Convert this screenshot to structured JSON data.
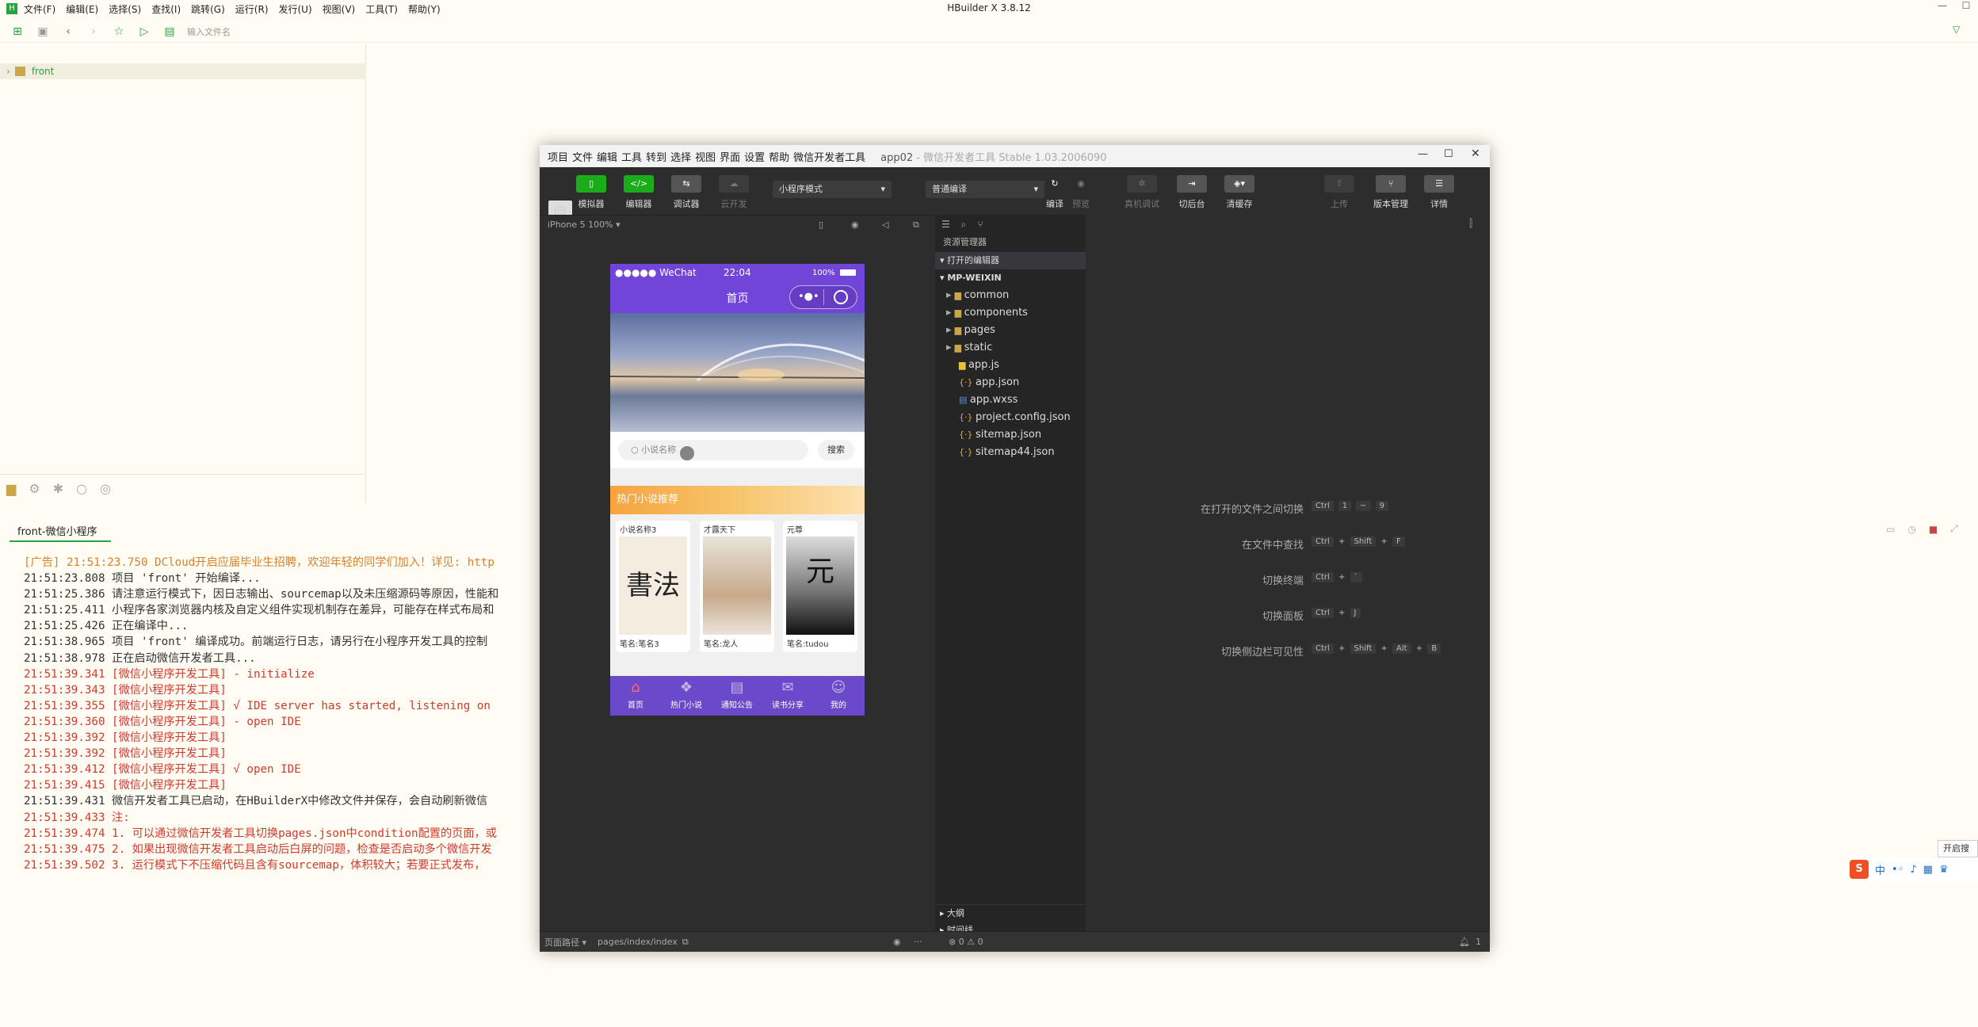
{
  "hbuilder": {
    "title": "HBuilder X 3.8.12",
    "menu": [
      "文件(F)",
      "编辑(E)",
      "选择(S)",
      "查找(I)",
      "跳转(G)",
      "运行(R)",
      "发行(U)",
      "视图(V)",
      "工具(T)",
      "帮助(Y)"
    ],
    "address_placeholder": "输入文件名",
    "project": "front",
    "console_tab": "front-微信小程序",
    "console_lines": [
      {
        "cls": "ln-ad",
        "text": "[广告] 21:51:23.750 DCloud开启应届毕业生招聘，欢迎年轻的同学们加入！详见: http"
      },
      {
        "cls": "ln-plain",
        "text": "21:51:23.808 项目 'front' 开始编译..."
      },
      {
        "cls": "ln-plain",
        "text": "21:51:25.386 请注意运行模式下，因日志输出、sourcemap以及未压缩源码等原因，性能和"
      },
      {
        "cls": "ln-plain",
        "text": "21:51:25.411 小程序各家浏览器内核及自定义组件实现机制存在差异，可能存在样式布局和"
      },
      {
        "cls": "ln-plain",
        "text": "21:51:25.426 正在编译中..."
      },
      {
        "cls": "ln-plain",
        "text": "21:51:38.965 项目 'front' 编译成功。前端运行日志，请另行在小程序开发工具的控制"
      },
      {
        "cls": "ln-plain",
        "text": "21:51:38.978 正在启动微信开发者工具..."
      },
      {
        "cls": "ln-red",
        "text": "21:51:39.341 [微信小程序开发工具] - initialize"
      },
      {
        "cls": "ln-red",
        "text": "21:51:39.343 [微信小程序开发工具]"
      },
      {
        "cls": "ln-red",
        "text": "21:51:39.355 [微信小程序开发工具] √ IDE server has started, listening on"
      },
      {
        "cls": "ln-red",
        "text": "21:51:39.360 [微信小程序开发工具] - open IDE"
      },
      {
        "cls": "ln-red",
        "text": "21:51:39.392 [微信小程序开发工具]"
      },
      {
        "cls": "ln-red",
        "text": "21:51:39.392 [微信小程序开发工具]"
      },
      {
        "cls": "ln-red",
        "text": "21:51:39.412 [微信小程序开发工具] √ open IDE"
      },
      {
        "cls": "ln-red",
        "text": "21:51:39.415 [微信小程序开发工具]"
      },
      {
        "cls": "ln-plain",
        "text": "21:51:39.431 微信开发者工具已启动，在HBuilderX中修改文件并保存，会自动刷新微信"
      },
      {
        "cls": "ln-red",
        "text": "21:51:39.433 注:"
      },
      {
        "cls": "ln-red",
        "text": "21:51:39.474 1. 可以通过微信开发者工具切换pages.json中condition配置的页面，或"
      },
      {
        "cls": "ln-red",
        "text": "21:51:39.475 2. 如果出现微信开发者工具启动后白屏的问题，检查是否启动多个微信开发"
      },
      {
        "cls": "ln-red",
        "text": "21:51:39.502 3. 运行模式下不压缩代码且含有sourcemap，体积较大；若要正式发布，"
      }
    ]
  },
  "wx": {
    "menu": [
      "项目",
      "文件",
      "编辑",
      "工具",
      "转到",
      "选择",
      "视图",
      "界面",
      "设置",
      "帮助",
      "微信开发者工具"
    ],
    "title_app": "app02",
    "title_rest": " - 微信开发者工具 Stable 1.03.2006090",
    "toolbar": {
      "simulator": "模拟器",
      "editor": "编辑器",
      "debugger": "调试器",
      "cloud": "云开发",
      "mode_select": "小程序模式",
      "compile_select": "普通编译",
      "compile": "编译",
      "preview": "预览",
      "remote_debug": "真机调试",
      "backend": "切后台",
      "clear_cache": "清缓存",
      "upload": "上传",
      "version": "版本管理",
      "details": "详情"
    },
    "device": "iPhone 5 100% ▾",
    "phone": {
      "carrier": "●●●●● WeChat",
      "time": "22:04",
      "battery": "100%",
      "nav_title": "首页",
      "search_placeholder": "小说名称",
      "search_btn": "搜索",
      "hot_title": "热门小说推荐",
      "cards": [
        {
          "title": "小说名称3",
          "author": "笔名:笔名3"
        },
        {
          "title": "才露天下",
          "author": "笔名:龙人"
        },
        {
          "title": "元尊",
          "author": "笔名:tudou"
        }
      ],
      "tabs": [
        "首页",
        "热门小说",
        "通知公告",
        "读书分享",
        "我的"
      ]
    },
    "explorer": {
      "header": "资源管理器",
      "open_editors": "打开的编辑器",
      "root": "MP-WEIXIN",
      "items": [
        {
          "name": "common",
          "type": "folder"
        },
        {
          "name": "components",
          "type": "folder"
        },
        {
          "name": "pages",
          "type": "folder"
        },
        {
          "name": "static",
          "type": "folder"
        },
        {
          "name": "app.js",
          "type": "js"
        },
        {
          "name": "app.json",
          "type": "json"
        },
        {
          "name": "app.wxss",
          "type": "wxss"
        },
        {
          "name": "project.config.json",
          "type": "json"
        },
        {
          "name": "sitemap.json",
          "type": "json"
        },
        {
          "name": "sitemap44.json",
          "type": "json"
        }
      ],
      "outline": "大纲",
      "timeline": "时间线"
    },
    "hints": [
      {
        "label": "在打开的文件之间切换",
        "keys": "Ctrl  1 ~ 9"
      },
      {
        "label": "在文件中查找",
        "keys": "Ctrl + Shift + F"
      },
      {
        "label": "切换终端",
        "keys": "Ctrl + `"
      },
      {
        "label": "切换面板",
        "keys": "Ctrl + J"
      },
      {
        "label": "切换侧边栏可见性",
        "keys": "Ctrl + Shift + Alt + B"
      }
    ],
    "status": {
      "page_path_label": "页面路径 ▾",
      "page_path": "pages/index/index",
      "problems": "⊗ 0 ⚠ 0",
      "notif": "1"
    }
  },
  "ime": {
    "tip": "开启搜"
  }
}
